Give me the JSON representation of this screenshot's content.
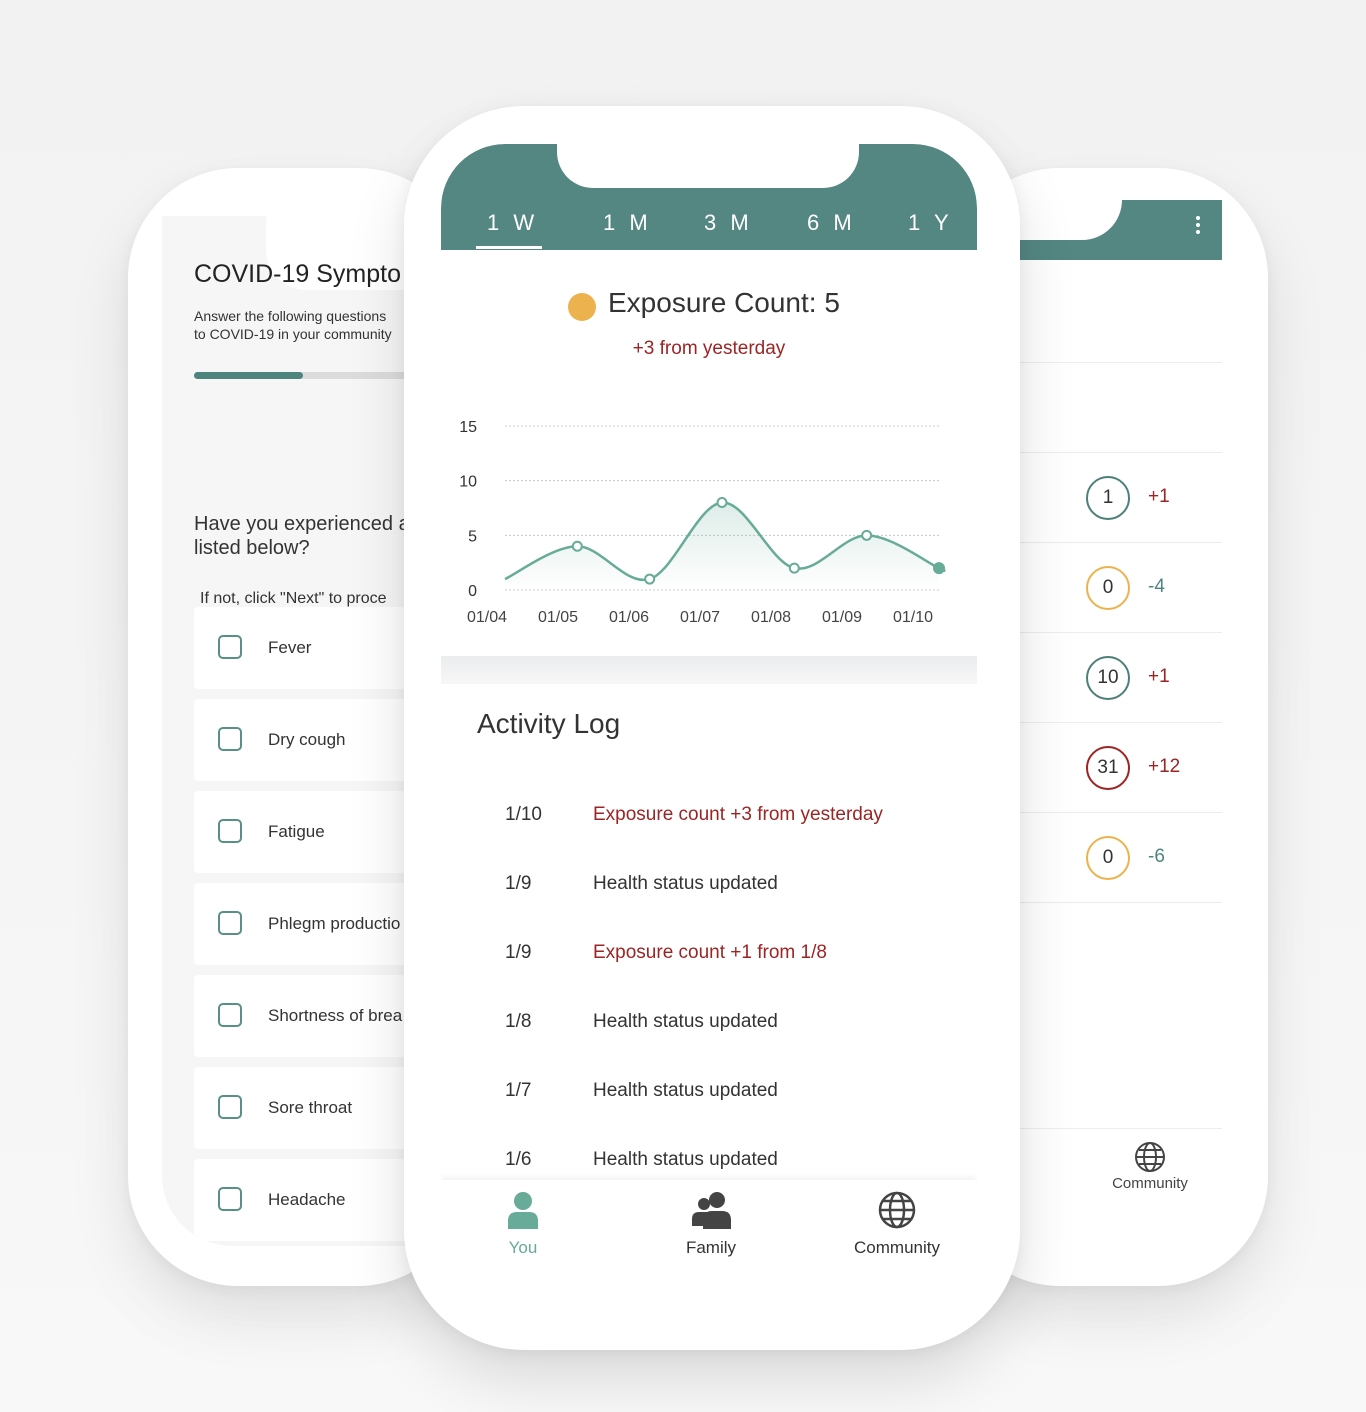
{
  "symptom_screen": {
    "title": "COVID-19 Sympto",
    "description_line1": "Answer the following questions",
    "description_line2": "to COVID-19 in your community",
    "progress_fraction": 0.42,
    "question_line1": "Have you experienced a",
    "question_line2": "listed below?",
    "hint": "If not, click \"Next\" to proce",
    "symptoms": [
      "Fever",
      "Dry cough",
      "Fatigue",
      "Phlegm productio",
      "Shortness of brea",
      "Sore throat",
      "Headache"
    ]
  },
  "community_screen": {
    "rows": [
      {
        "count": "1",
        "delta": "+1",
        "ring_color": "#4d7f79",
        "delta_color": "#9c2424"
      },
      {
        "count": "0",
        "delta": "-4",
        "ring_color": "#ecb24d",
        "delta_color": "#4d847d"
      },
      {
        "count": "10",
        "delta": "+1",
        "ring_color": "#4d7f79",
        "delta_color": "#9c2424"
      },
      {
        "count": "31",
        "delta": "+12",
        "ring_color": "#9c2424",
        "delta_color": "#9c2424"
      },
      {
        "count": "0",
        "delta": "-6",
        "ring_color": "#ecb24d",
        "delta_color": "#4d847d"
      }
    ],
    "nav_label": "Community"
  },
  "exposure_screen": {
    "tabs": [
      "1 W",
      "1 M",
      "3 M",
      "6 M",
      "1 Y"
    ],
    "active_tab": "1 W",
    "exposure_label": "Exposure Count: 5",
    "exposure_delta": "+3 from yesterday",
    "activity_title": "Activity Log",
    "activity_log": [
      {
        "date": "1/10",
        "message": "Exposure count +3 from yesterday",
        "alert": true
      },
      {
        "date": "1/9",
        "message": "Health status updated",
        "alert": false
      },
      {
        "date": "1/9",
        "message": "Exposure count +1 from 1/8",
        "alert": true
      },
      {
        "date": "1/8",
        "message": "Health status updated",
        "alert": false
      },
      {
        "date": "1/7",
        "message": "Health status updated",
        "alert": false
      },
      {
        "date": "1/6",
        "message": "Health status updated",
        "alert": false
      }
    ],
    "nav": [
      {
        "label": "You",
        "icon": "user-icon",
        "active": true
      },
      {
        "label": "Family",
        "icon": "family-icon",
        "active": false
      },
      {
        "label": "Community",
        "icon": "globe-icon",
        "active": false
      }
    ]
  },
  "colors": {
    "brand_teal": "#548782",
    "accent_green": "#67ab98",
    "alert_red": "#9c2424",
    "exposure_yellow": "#ecb24d"
  },
  "chart_data": {
    "type": "line",
    "x": [
      "01/04",
      "01/05",
      "01/06",
      "01/07",
      "01/08",
      "01/09",
      "01/10"
    ],
    "series": [
      {
        "values": [
          1,
          4,
          1,
          8,
          2,
          5,
          2
        ]
      }
    ],
    "y_ticks": [
      0,
      5,
      10,
      15
    ],
    "ylim": [
      0,
      15
    ],
    "grid": true,
    "line_color": "#67ab98"
  }
}
